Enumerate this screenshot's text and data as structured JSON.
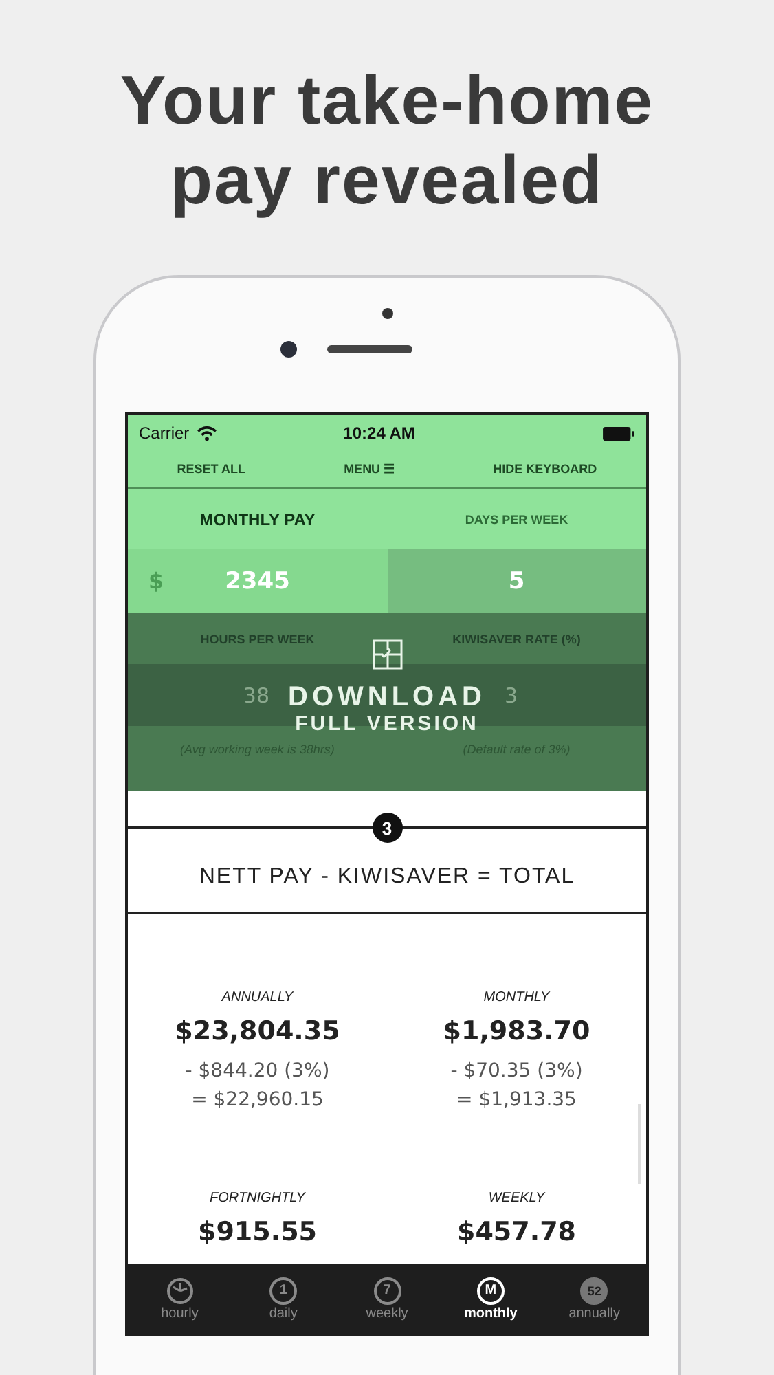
{
  "headline": [
    "Your take-home",
    "pay revealed"
  ],
  "status_bar": {
    "carrier": "Carrier",
    "time": "10:24 AM"
  },
  "nav": [
    "RESET ALL",
    "MENU ☰",
    "HIDE KEYBOARD"
  ],
  "inputs": [
    {
      "label": "MONTHLY PAY",
      "prefix": "$",
      "value": "2345",
      "selected": true
    },
    {
      "label": "DAYS PER WEEK",
      "value": "5",
      "selected": false
    },
    {
      "label": "HOURS PER WEEK",
      "value": "38",
      "hint": "(Avg working week is 38hrs)",
      "selected": false
    },
    {
      "label": "KIWISAVER RATE (%)",
      "value": "3",
      "hint": "(Default rate of 3%)",
      "selected": false
    }
  ],
  "overlay": {
    "title": "DOWNLOAD",
    "subtitle": "FULL VERSION"
  },
  "step": "3",
  "heading": "NETT PAY - KIWISAVER = TOTAL",
  "results": [
    {
      "period": "ANNUALLY",
      "amount": "$23,804.35",
      "deduction": "- $844.20 (3%)",
      "total": "= $22,960.15"
    },
    {
      "period": "MONTHLY",
      "amount": "$1,983.70",
      "deduction": "- $70.35 (3%)",
      "total": "= $1,913.35"
    },
    {
      "period": "FORTNIGHTLY",
      "amount": "$915.55"
    },
    {
      "period": "WEEKLY",
      "amount": "$457.78"
    }
  ],
  "tabs": [
    {
      "kind": "clock",
      "label": "hourly",
      "selected": false
    },
    {
      "kind": "badge",
      "icon_text": "1",
      "label": "daily",
      "selected": false
    },
    {
      "kind": "badge",
      "icon_text": "7",
      "label": "weekly",
      "selected": false
    },
    {
      "kind": "badge",
      "icon_text": "M",
      "label": "monthly",
      "selected": true
    },
    {
      "kind": "filled",
      "icon_text": "52",
      "label": "annually",
      "selected": false
    }
  ]
}
